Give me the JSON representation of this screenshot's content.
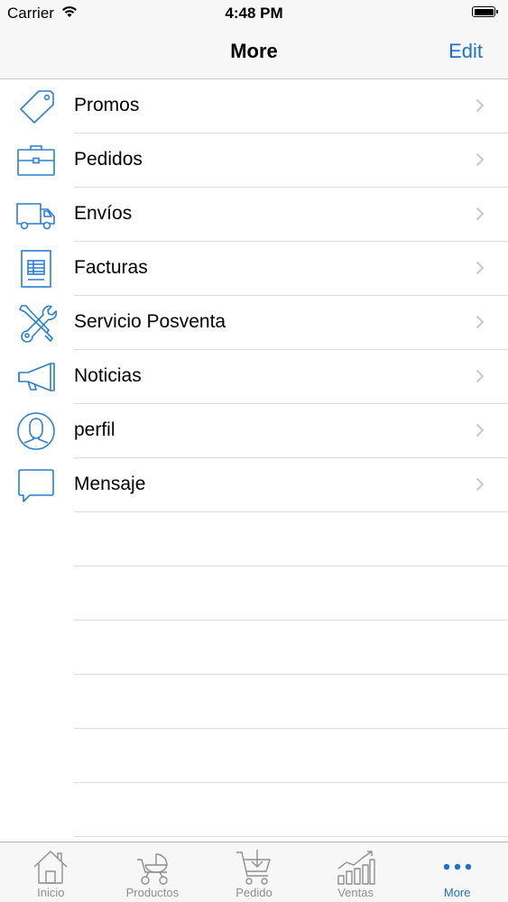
{
  "status_bar": {
    "carrier": "Carrier",
    "time": "4:48 PM"
  },
  "nav_bar": {
    "title": "More",
    "edit_label": "Edit"
  },
  "menu": {
    "items": [
      {
        "label": "Promos",
        "icon": "tag-icon"
      },
      {
        "label": "Pedidos",
        "icon": "briefcase-icon"
      },
      {
        "label": "Envíos",
        "icon": "truck-icon"
      },
      {
        "label": "Facturas",
        "icon": "invoice-icon"
      },
      {
        "label": "Servicio Posventa",
        "icon": "tools-icon"
      },
      {
        "label": "Noticias",
        "icon": "megaphone-icon"
      },
      {
        "label": "perfil",
        "icon": "profile-icon"
      },
      {
        "label": "Mensaje",
        "icon": "message-icon"
      }
    ]
  },
  "tab_bar": {
    "tabs": [
      {
        "label": "Inicio",
        "icon": "home-icon"
      },
      {
        "label": "Productos",
        "icon": "stroller-icon"
      },
      {
        "label": "Pedido",
        "icon": "cart-icon"
      },
      {
        "label": "Ventas",
        "icon": "bar-chart-icon"
      },
      {
        "label": "More",
        "icon": "more-icon"
      }
    ],
    "active_index": 4
  },
  "colors": {
    "accent": "#1a73c8",
    "icon_blue": "#2a7fd0",
    "inactive": "#8e8e93",
    "chevron": "#c7c7cc",
    "separator": "#dcdce0",
    "bar_background": "#f7f7f7"
  }
}
